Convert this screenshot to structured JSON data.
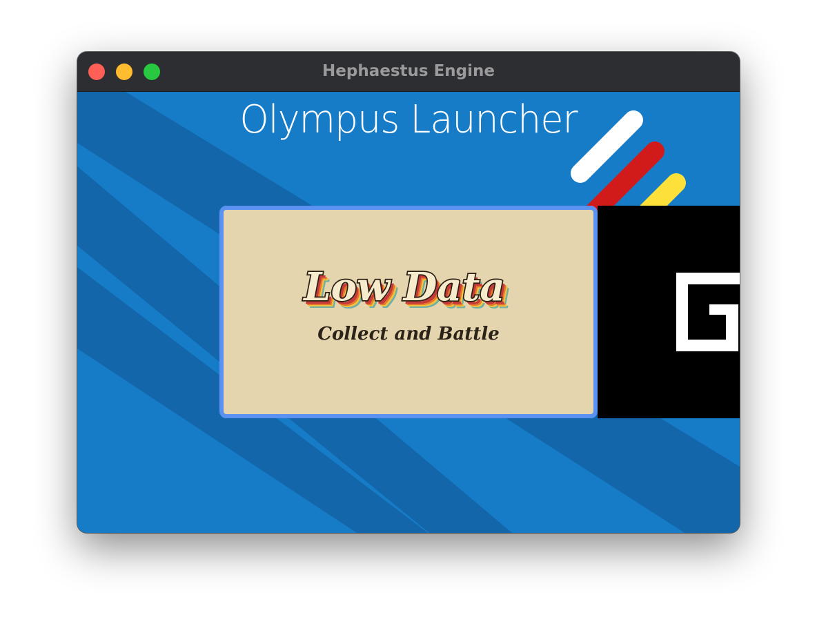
{
  "window": {
    "title": "Hephaestus Engine",
    "traffic_lights": [
      {
        "name": "close",
        "color": "#fe5f57"
      },
      {
        "name": "minimize",
        "color": "#febc2e"
      },
      {
        "name": "zoom",
        "color": "#28c840"
      }
    ]
  },
  "launcher": {
    "title": "Olympus Launcher",
    "background_color": "#177cc7",
    "stripe_color": "#1366aa",
    "accent_colors": [
      "#ffffff",
      "#d11a1a",
      "#fde03a"
    ]
  },
  "games": [
    {
      "title": "Low Data",
      "subtitle": "Collect and Battle",
      "selected": true,
      "tile_color": "#e4d5ae",
      "highlight_color": "#5b92f2"
    },
    {
      "tile_color": "#000000",
      "selected": false
    }
  ]
}
